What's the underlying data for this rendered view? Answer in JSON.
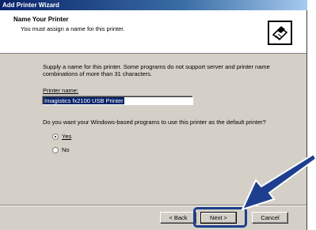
{
  "window": {
    "title": "Add Printer Wizard"
  },
  "header": {
    "title": "Name Your Printer",
    "subtitle": "You must assign a name for this printer.",
    "icon": "printer-icon"
  },
  "intro": {
    "line1": "Supply a name for this printer. Some programs do not support server and printer name",
    "line2": "combinations of more than 31 characters."
  },
  "printer_name": {
    "label": "Printer name:",
    "value": "Imagistics fx2100 USB Printer"
  },
  "default_question": "Do you want your Windows-based programs to use this printer as the default printer?",
  "radios": [
    {
      "label": "Yes",
      "selected": true
    },
    {
      "label": "No",
      "selected": false
    }
  ],
  "buttons": {
    "back": "< Back",
    "next": "Next >",
    "cancel": "Cancel"
  },
  "colors": {
    "title_bar": "#0a246a",
    "highlight": "#1e3f8f",
    "selection": "#0a246a"
  }
}
